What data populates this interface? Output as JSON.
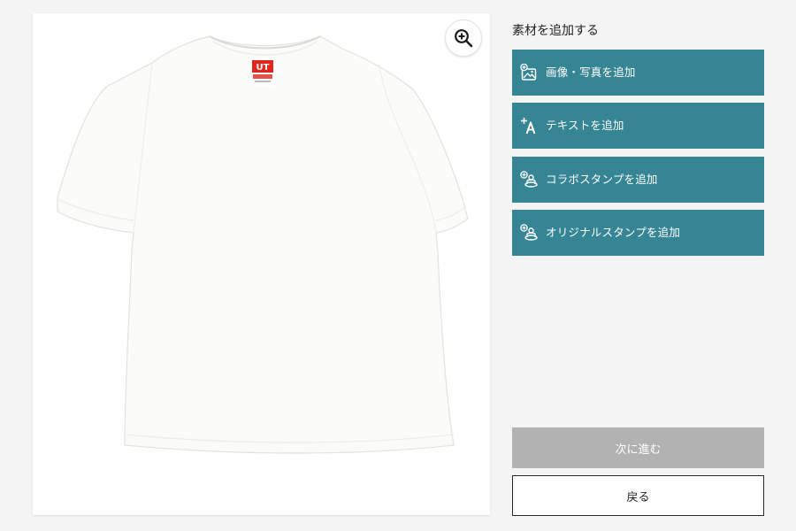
{
  "colors": {
    "page_background": "#f4f4f4",
    "accent": "#358595",
    "disabled": "#b2b2b2",
    "text": "#222222"
  },
  "preview": {
    "zoom_icon": "zoom-in-icon",
    "product_image": "white t-shirt",
    "tag_label": "UT"
  },
  "sidebar": {
    "section_title": "素材を追加する",
    "actions": [
      {
        "label": "画像・写真を追加",
        "icon": "add-image-icon"
      },
      {
        "label": "テキストを追加",
        "icon": "add-text-icon"
      },
      {
        "label": "コラボスタンプを追加",
        "icon": "add-stamp-icon"
      },
      {
        "label": "オリジナルスタンプを追加",
        "icon": "add-stamp-icon"
      }
    ]
  },
  "footer": {
    "next_label": "次に進む",
    "back_label": "戻る"
  }
}
